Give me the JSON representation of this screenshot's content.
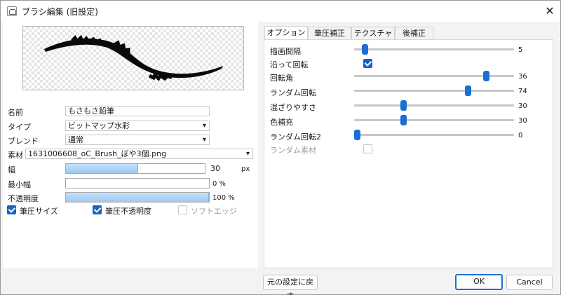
{
  "window": {
    "title": "ブラシ編集 (旧設定)",
    "close_glyph": "✕"
  },
  "preview": {
    "alt": ""
  },
  "fields": {
    "name_label": "名前",
    "name_value": "もさもさ鉛筆",
    "type_label": "タイプ",
    "type_value": "ビットマップ水彩",
    "blend_label": "ブレンド",
    "blend_value": "通常",
    "material_label": "素材",
    "material_value": "1631006608_oC_Brush_ぼや3個.png"
  },
  "width": {
    "label": "幅",
    "value": "30",
    "unit": "px",
    "fill_fraction": 0.52
  },
  "min_width": {
    "label": "最小幅",
    "value_text": "0 %",
    "fill_fraction": 0.0
  },
  "opacity": {
    "label": "不透明度",
    "value_text": "100 %",
    "fill_fraction": 1.0
  },
  "checks": {
    "pressure_size": {
      "label": "筆圧サイズ",
      "checked": true
    },
    "pressure_opacity": {
      "label": "筆圧不透明度",
      "checked": true
    },
    "soft_edge": {
      "label": "ソフトエッジ",
      "checked": false
    }
  },
  "tabs": [
    "オプション",
    "筆圧補正",
    "テクスチャ",
    "後補正"
  ],
  "options": {
    "interval": {
      "label": "描画間隔",
      "value": "5",
      "fraction": 0.05
    },
    "follow_rotation": {
      "label": "沿って回転",
      "checked": true
    },
    "rotation_angle": {
      "label": "回転角",
      "value": "36",
      "fraction": 0.84
    },
    "random_rotation": {
      "label": "ランダム回転",
      "value": "74",
      "fraction": 0.72
    },
    "mixing": {
      "label": "混ざりやすさ",
      "value": "30",
      "fraction": 0.3
    },
    "color_fill": {
      "label": "色補充",
      "value": "30",
      "fraction": 0.3
    },
    "random_rotation2": {
      "label": "ランダム回転2",
      "value": "0",
      "fraction": 0.0
    },
    "random_material": {
      "label": "ランダム素材",
      "checked": false
    }
  },
  "buttons": {
    "reset": "元の設定に戻す",
    "ok": "OK",
    "cancel": "Cancel"
  },
  "colors": {
    "accent": "#1a6fd4",
    "fill": "#a7d0f5"
  }
}
